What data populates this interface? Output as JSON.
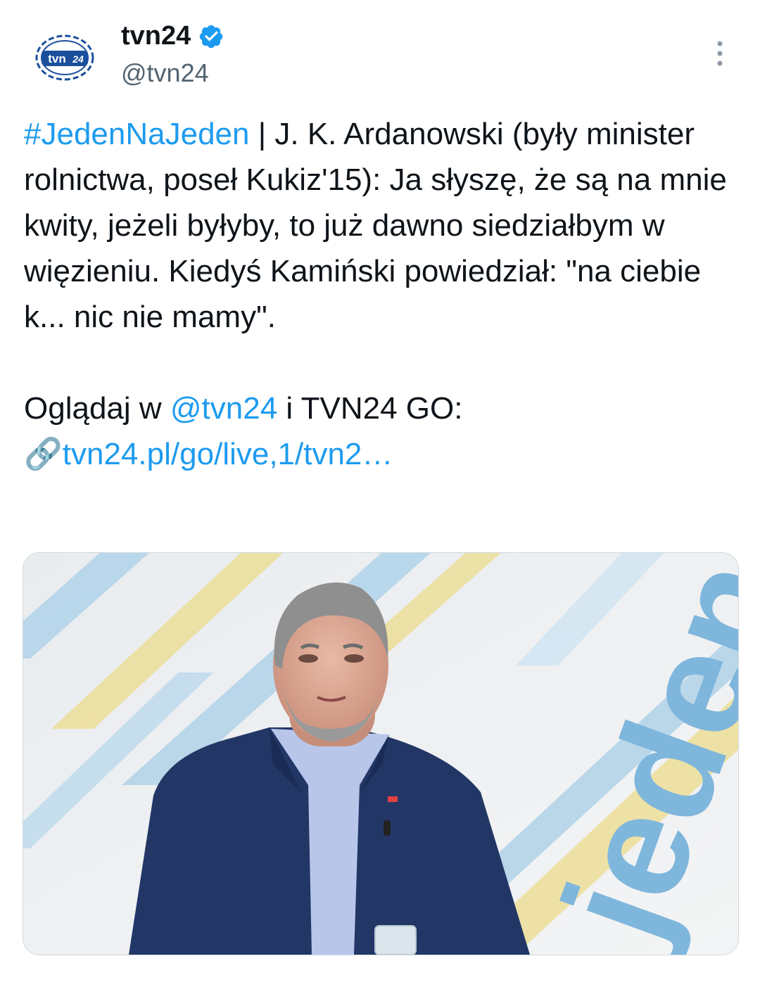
{
  "account": {
    "display_name": "tvn24",
    "handle": "@tvn24",
    "avatar_icon": "tvn24-logo",
    "verified_icon": "verified-badge-icon",
    "brand_color": "#1d9bf0"
  },
  "tweet": {
    "hashtag": "#JedenNaJeden",
    "text_1": " | J. K. Ardanowski (były minister rolnictwa, poseł Kukiz'15): Ja słyszę, że są na mnie kwity, jeżeli byłyby, to już dawno siedziałbym w więzieniu. Kiedyś Kamiński powiedział: \"na ciebie k... nic nie mamy\".\n\nOglądaj w ",
    "mention": "@tvn24",
    "text_2": " i TVN24 GO:\n",
    "link_emoji": "🔗",
    "link_text": "tvn24.pl/go/live,1/tvn2…"
  },
  "media": {
    "logo_text": "tvn",
    "logo_badge": "24",
    "background_text": "jeden"
  }
}
